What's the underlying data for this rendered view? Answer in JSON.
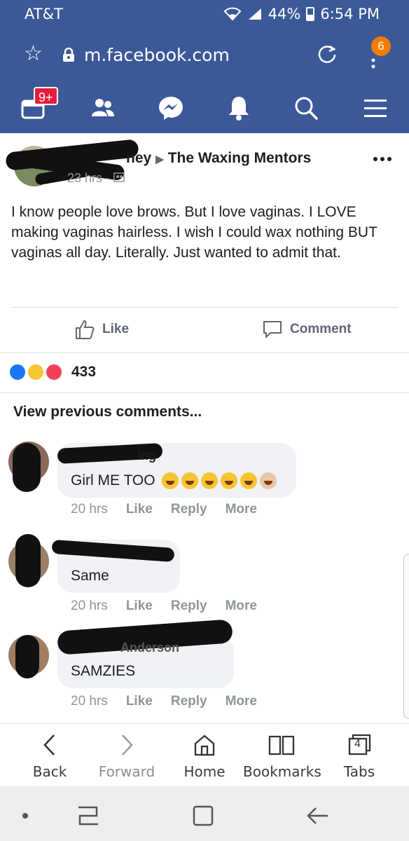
{
  "status_bar": {
    "carrier": "AT&T",
    "battery": "44%",
    "time": "6:54 PM"
  },
  "browser": {
    "url": "m.facebook.com",
    "menu_badge": "6"
  },
  "fb_nav": {
    "notifications_badge": "9+"
  },
  "post": {
    "author_visible": "ney",
    "group": "The Waxing Mentors",
    "time": "23 hrs",
    "text": "I know people love brows. But I love vaginas. I LOVE making vaginas hairless. I wish I could wax nothing BUT vaginas all day. Literally. Just wanted to admit that.",
    "like_label": "Like",
    "comment_label": "Comment",
    "reaction_count": "433",
    "view_previous": "View previous comments..."
  },
  "comments": [
    {
      "name_visible": "ing",
      "text": "Girl ME TOO",
      "time": "20 hrs",
      "like": "Like",
      "reply": "Reply",
      "more": "More"
    },
    {
      "name_visible": "",
      "text": "Same",
      "time": "20 hrs",
      "like": "Like",
      "reply": "Reply",
      "more": "More"
    },
    {
      "name_visible": "Anderson",
      "text": "SAMZIES",
      "time": "20 hrs",
      "like": "Like",
      "reply": "Reply",
      "more": "More"
    }
  ],
  "toolbar": {
    "back": "Back",
    "forward": "Forward",
    "home": "Home",
    "bookmarks": "Bookmarks",
    "tabs": "Tabs",
    "tab_count": "4"
  },
  "colors": {
    "facebook_blue": "#3b5998",
    "badge_red": "#e41e3f",
    "badge_orange": "#f57c00"
  }
}
